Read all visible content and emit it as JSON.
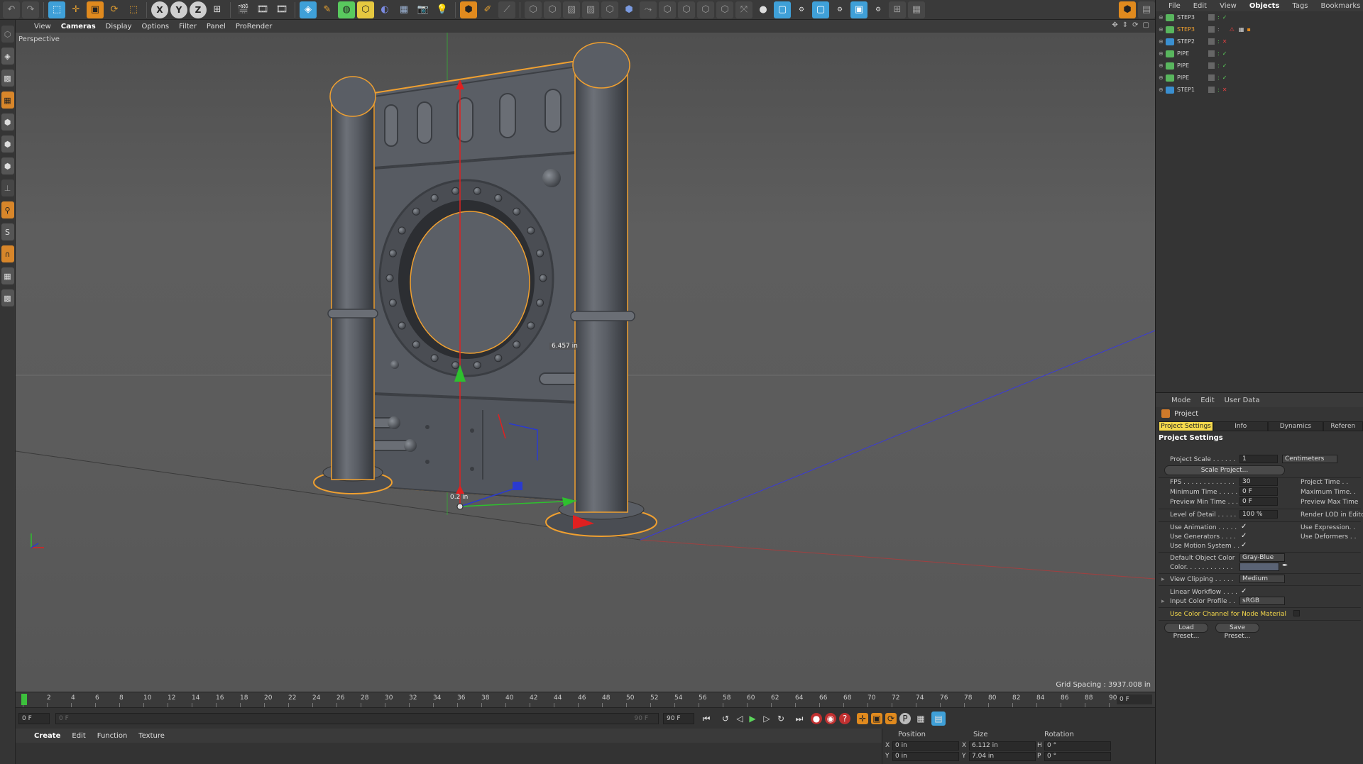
{
  "toolbar": {
    "axis_x": "X",
    "axis_y": "Y",
    "axis_z": "Z"
  },
  "viewport": {
    "menu": [
      "View",
      "Cameras",
      "Display",
      "Options",
      "Filter",
      "Panel",
      "ProRender"
    ],
    "label": "Perspective",
    "dimension_label": "6.457 in",
    "origin_label": "0.2 in",
    "grid_spacing": "Grid Spacing : 3937.008 in"
  },
  "timeline": {
    "ticks": [
      "0",
      "2",
      "4",
      "6",
      "8",
      "10",
      "12",
      "14",
      "16",
      "18",
      "20",
      "22",
      "24",
      "26",
      "28",
      "30",
      "32",
      "34",
      "36",
      "38",
      "40",
      "42",
      "44",
      "46",
      "48",
      "50",
      "52",
      "54",
      "56",
      "58",
      "60",
      "62",
      "64",
      "66",
      "68",
      "70",
      "72",
      "74",
      "76",
      "78",
      "80",
      "82",
      "84",
      "86",
      "88",
      "90"
    ],
    "end_frame": "0 F"
  },
  "playback": {
    "current_frame": "0 F",
    "range_start": "0 F",
    "range_end": "90 F",
    "max_frame": "90 F"
  },
  "material_menu": [
    "Create",
    "Edit",
    "Function",
    "Texture"
  ],
  "coordinates": {
    "headers": [
      "Position",
      "Size",
      "Rotation"
    ],
    "x_pos": "0 in",
    "x_size": "6.112 in",
    "h_rot": "0 °",
    "y_pos": "0 in",
    "y_size": "7.04 in",
    "p_rot": "0 °",
    "labels": {
      "x": "X",
      "y": "Y",
      "h": "H",
      "p": "P"
    }
  },
  "object_manager": {
    "menu": [
      "File",
      "Edit",
      "View",
      "Objects",
      "Tags",
      "Bookmarks"
    ],
    "objects": [
      {
        "name": "STEP3"
      },
      {
        "name": "STEP3"
      },
      {
        "name": "STEP2"
      },
      {
        "name": "PIPE"
      },
      {
        "name": "PIPE"
      },
      {
        "name": "PIPE"
      },
      {
        "name": "STEP1"
      }
    ]
  },
  "attributes": {
    "menu": [
      "Mode",
      "Edit",
      "User Data"
    ],
    "object": "Project",
    "tabs": [
      "Project Settings",
      "Info",
      "Dynamics",
      "Referen"
    ],
    "section": "Project Settings",
    "project_scale_label": "Project Scale . . . . . .",
    "project_scale_value": "1",
    "project_scale_unit": "Centimeters",
    "scale_project_button": "Scale Project...",
    "fps_label": "FPS . . . . . . . . . . . . .",
    "fps_value": "30",
    "min_time_label": "Minimum Time . . . . .",
    "min_time_value": "0 F",
    "preview_min_label": "Preview Min Time . . .",
    "preview_min_value": "0 F",
    "project_time_label": "Project Time . .",
    "max_time_label": "Maximum Time. .",
    "preview_max_label": "Preview Max Time",
    "lod_label": "Level of Detail . . . . .",
    "lod_value": "100 %",
    "render_lod_label": "Render LOD in Edito",
    "use_animation_label": "Use Animation . . . . .",
    "use_generators_label": "Use Generators . . . .",
    "use_motion_label": "Use Motion System . .",
    "use_expression_label": "Use Expression. .",
    "use_deformers_label": "Use Deformers . .",
    "default_color_label": "Default Object Color",
    "default_color_value": "Gray-Blue",
    "color_label": "Color. . . . . . . . . . . .",
    "view_clipping_label": "View Clipping . . . . .",
    "view_clipping_value": "Medium",
    "linear_workflow_label": "Linear Workflow . . . .",
    "input_profile_label": "Input Color Profile . .",
    "input_profile_value": "sRGB",
    "node_material_label": "Use Color Channel for Node Material",
    "load_preset": "Load Preset...",
    "save_preset": "Save Preset...",
    "check_mark": "✓"
  },
  "colors": {
    "accent_orange": "#e08a1e",
    "selection_yellow": "#f5d94c",
    "axis_red": "#e02020",
    "axis_green": "#2ec02e",
    "axis_blue": "#2a3ad0",
    "model_gray": "#5d6168"
  }
}
